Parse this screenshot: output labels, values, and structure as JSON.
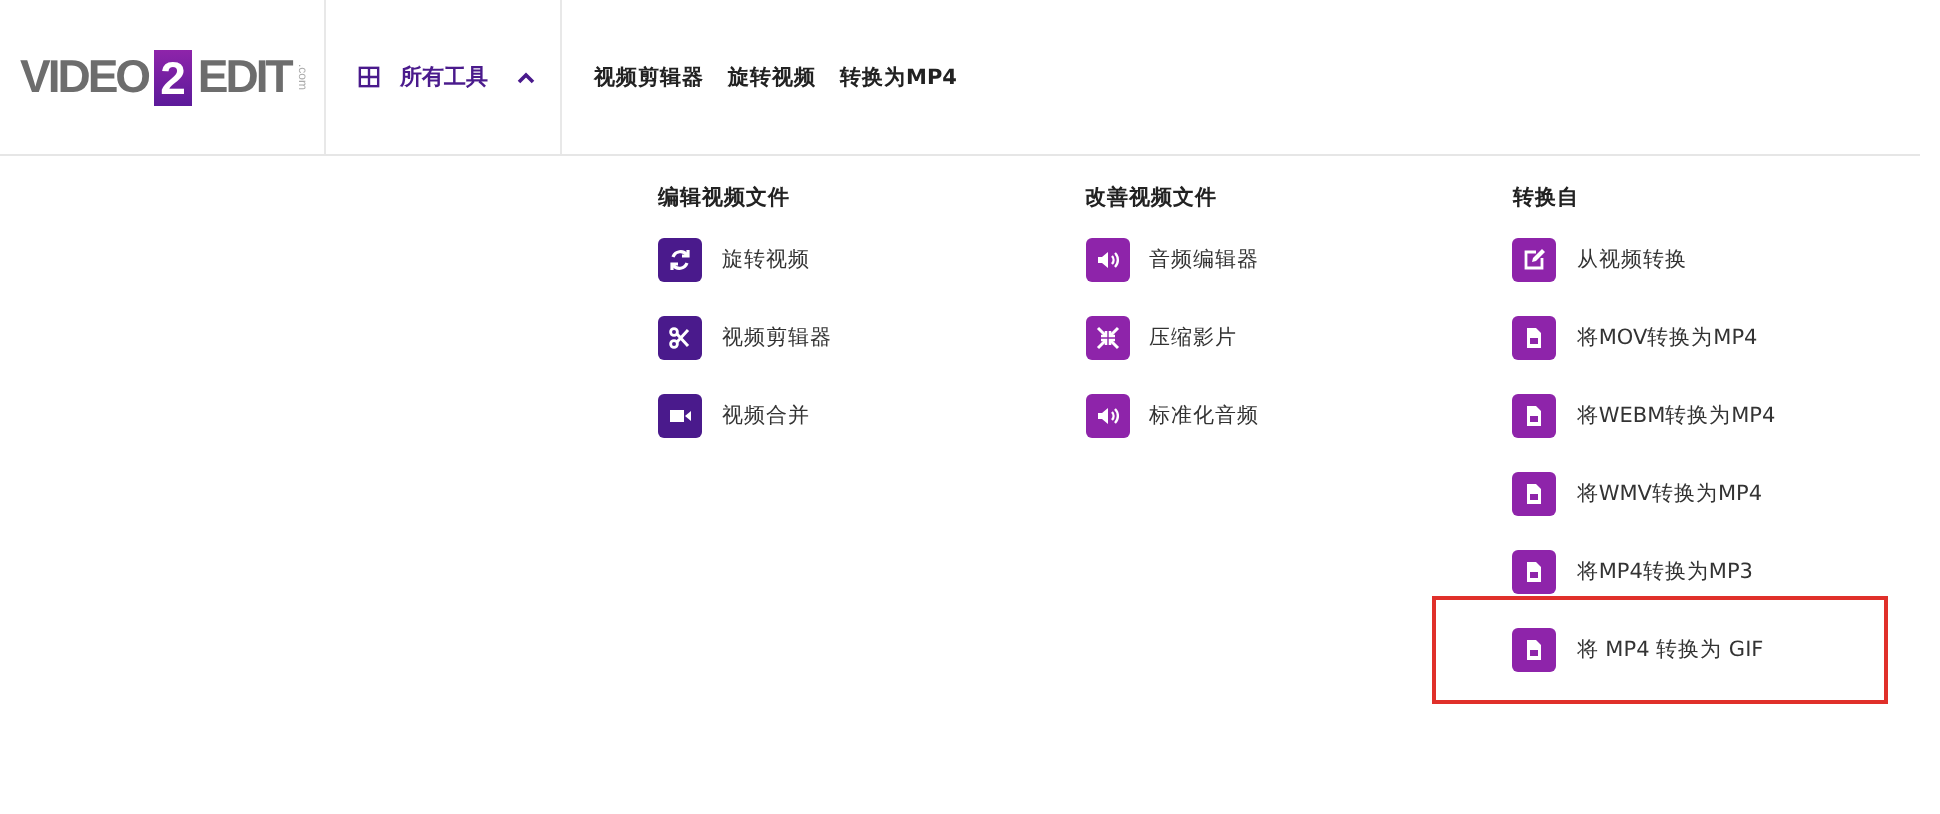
{
  "logo": {
    "left": "VIDEO",
    "mark": "2",
    "right": "EDIT",
    "suffix": ".com"
  },
  "tools_menu": {
    "label": "所有工具",
    "expanded": true
  },
  "nav_links": [
    "视频剪辑器",
    "旋转视频",
    "转换为MP4"
  ],
  "columns": [
    {
      "heading": "编辑视频文件",
      "items": [
        {
          "label": "旋转视频",
          "kind": "rotate",
          "highlighted": false
        },
        {
          "label": "视频剪辑器",
          "kind": "scissors",
          "highlighted": false
        },
        {
          "label": "视频合并",
          "kind": "camera",
          "highlighted": false
        }
      ]
    },
    {
      "heading": "改善视频文件",
      "items": [
        {
          "label": "音频编辑器",
          "kind": "speaker",
          "highlighted": false
        },
        {
          "label": "压缩影片",
          "kind": "compress",
          "highlighted": false
        },
        {
          "label": "标准化音频",
          "kind": "speaker",
          "highlighted": false
        }
      ]
    },
    {
      "heading": "转换自",
      "items": [
        {
          "label": "从视频转换",
          "kind": "edit",
          "highlighted": false
        },
        {
          "label": "将MOV转换为MP4",
          "kind": "file",
          "highlighted": false
        },
        {
          "label": "将WEBM转换为MP4",
          "kind": "file",
          "highlighted": false
        },
        {
          "label": "将WMV转换为MP4",
          "kind": "file",
          "highlighted": false
        },
        {
          "label": "将MP4转换为MP3",
          "kind": "file",
          "highlighted": false
        },
        {
          "label": "将 MP4 转换为 GIF",
          "kind": "file",
          "highlighted": true
        }
      ]
    }
  ]
}
